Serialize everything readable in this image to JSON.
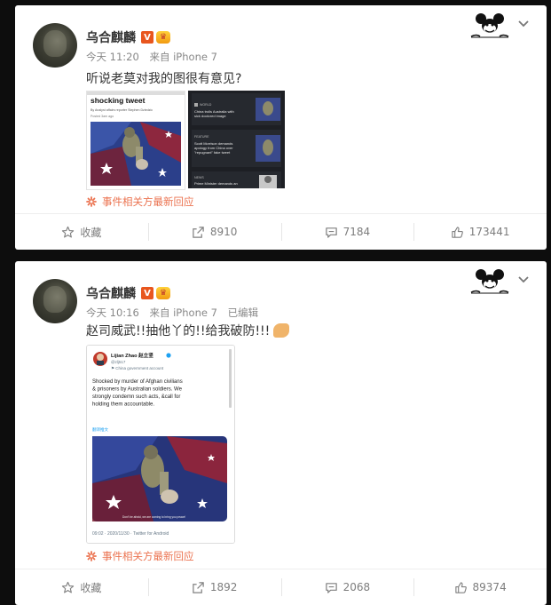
{
  "posts": [
    {
      "author": "乌合麒麟",
      "time": "今天 11:20",
      "source": "来自 iPhone 7",
      "edited": "",
      "text": "听说老莫对我的图很有意见?",
      "topic": "事件相关方最新回应",
      "image1": {
        "headline": "shocking tweet",
        "byline": "By Analyst affairs reporter Stephen Dziedzic",
        "posted": "Posted 3am ago"
      },
      "image2": {
        "items": [
          "China trolls Australia with sick doctored image",
          "Scott Morrison demands apology from China over \"repugnant\" fake tweet",
          "Prime Minister demands an"
        ],
        "tags": [
          "WORLD",
          "FEATURE",
          "NEWS"
        ]
      },
      "actions": {
        "favorite": "收藏",
        "repost": "8910",
        "comment": "7184",
        "like": "173441"
      }
    },
    {
      "author": "乌合麒麟",
      "time": "今天 10:16",
      "source": "来自 iPhone 7",
      "edited": "已编辑",
      "text": "赵司威武!!抽他丫的!!给我破防!!!",
      "topic": "事件相关方最新回应",
      "tweet": {
        "name": "Lijian Zhao 赵立坚",
        "handle": "@zlj517",
        "label": "China government account",
        "body": "Shocked by murder of Afghan civilians & prisoners by Australian soldiers. We strongly condemn such acts, &call for holding them accountable.",
        "translate": "翻译推文",
        "caption": "Don't be afraid, we are coming to bring you peace!",
        "footer": "09:02 · 2020/11/30 · Twitter for Android"
      },
      "actions": {
        "favorite": "收藏",
        "repost": "1892",
        "comment": "2068",
        "like": "89374"
      }
    }
  ],
  "colors": {
    "accent": "#eb7350",
    "vip": "#e8561e",
    "background": "#0d0d0d"
  },
  "icons": [
    "star-icon",
    "repost-icon",
    "comment-icon",
    "like-icon",
    "chevron-down-icon",
    "mickey-decoration-icon"
  ]
}
